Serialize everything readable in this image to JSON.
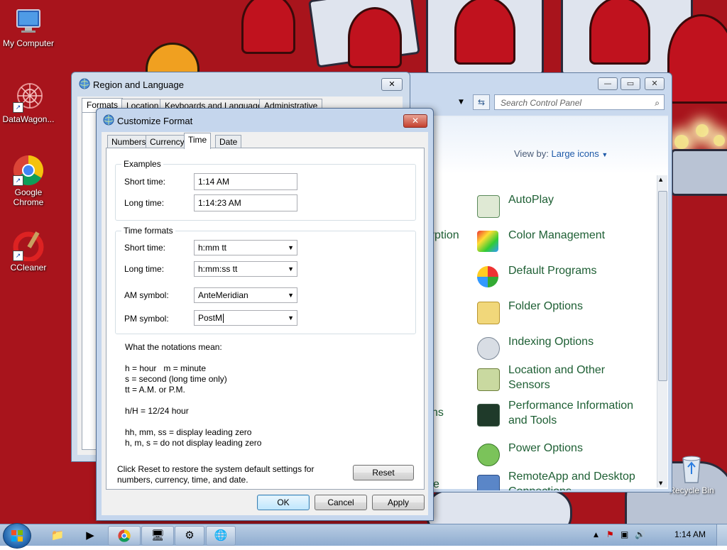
{
  "desktop": {
    "icons": [
      {
        "label": "My Computer"
      },
      {
        "label": "DataWagon..."
      },
      {
        "label": "Google Chrome"
      },
      {
        "label": "CCleaner"
      },
      {
        "label": "Recycle Bin"
      }
    ]
  },
  "control_panel": {
    "search_placeholder": "Search Control Panel",
    "view_by_label": "View by:",
    "view_by_value": "Large icons",
    "partial_labels": [
      "yption",
      "ns",
      "e"
    ],
    "items": [
      {
        "label": "AutoPlay"
      },
      {
        "label": "Color Management"
      },
      {
        "label": "Default Programs"
      },
      {
        "label": "Folder Options"
      },
      {
        "label": "Indexing Options"
      },
      {
        "label": "Location and Other Sensors"
      },
      {
        "label": "Performance Information and Tools"
      },
      {
        "label": "Power Options"
      },
      {
        "label": "RemoteApp and Desktop Connections"
      }
    ]
  },
  "region_language": {
    "title": "Region and Language",
    "tabs": [
      "Formats",
      "Location",
      "Keyboards and Languages",
      "Administrative"
    ]
  },
  "customize_format": {
    "title": "Customize Format",
    "tabs": [
      "Numbers",
      "Currency",
      "Time",
      "Date"
    ],
    "active_tab": "Time",
    "examples": {
      "legend": "Examples",
      "short_time_label": "Short time:",
      "short_time_value": "1:14 AM",
      "long_time_label": "Long time:",
      "long_time_value": "1:14:23 AM"
    },
    "formats": {
      "legend": "Time formats",
      "short_time_label": "Short time:",
      "short_time_value": "h:mm tt",
      "long_time_label": "Long time:",
      "long_time_value": "h:mm:ss tt",
      "am_label": "AM symbol:",
      "am_value": "AnteMeridian",
      "pm_label": "PM symbol:",
      "pm_value": "PostM"
    },
    "notes": {
      "heading": "What the notations mean:",
      "line1": "h = hour   m = minute",
      "line2": "s = second (long time only)",
      "line3": "tt = A.M. or P.M.",
      "line4": "h/H = 12/24 hour",
      "line5": "hh, mm, ss = display leading zero",
      "line6": "h, m, s = do not display leading zero"
    },
    "reset_note_1": "Click Reset to restore the system default settings for",
    "reset_note_2": "numbers, currency, time, and date.",
    "reset_label": "Reset",
    "ok_label": "OK",
    "cancel_label": "Cancel",
    "apply_label": "Apply"
  },
  "taskbar": {
    "clock": "1:14 AM"
  }
}
